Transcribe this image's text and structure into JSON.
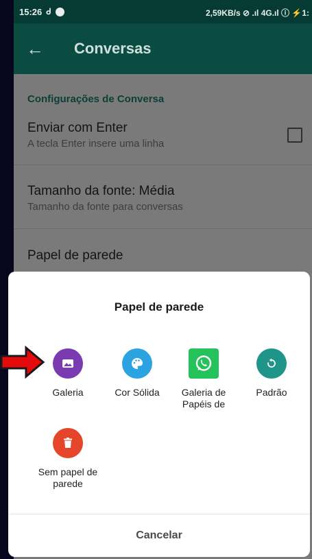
{
  "status_bar": {
    "time": "15:26",
    "right_text": "2,59KB/s ⊘ .ıl 4G.ıl ⓘ ⚡1:"
  },
  "toolbar": {
    "title": "Conversas",
    "back_icon": "arrow-left-icon"
  },
  "settings": {
    "section_header": "Configurações de Conversa",
    "items": [
      {
        "title": "Enviar com Enter",
        "subtitle": "A tecla Enter insere uma linha"
      },
      {
        "title": "Tamanho da fonte: Média",
        "subtitle": "Tamanho da fonte para conversas"
      },
      {
        "title": "Papel de parede",
        "subtitle": ""
      }
    ]
  },
  "dialog": {
    "title": "Papel de parede",
    "options": [
      {
        "label": "Galeria",
        "icon": "image-icon",
        "color": "#7b3bb0"
      },
      {
        "label": "Cor Sólida",
        "icon": "palette-icon",
        "color": "#2aa3e0"
      },
      {
        "label": "Galeria de Papéis de",
        "icon": "whatsapp-icon",
        "color": "#25c15a"
      },
      {
        "label": "Padrão",
        "icon": "reset-icon",
        "color": "#1f9488"
      },
      {
        "label": "Sem papel de parede",
        "icon": "trash-icon",
        "color": "#e5452a"
      }
    ],
    "cancel_label": "Cancelar"
  },
  "colors": {
    "toolbar": "#0a4c42",
    "status_bar": "#063b33",
    "accent_arrow": "#e30b0b"
  }
}
